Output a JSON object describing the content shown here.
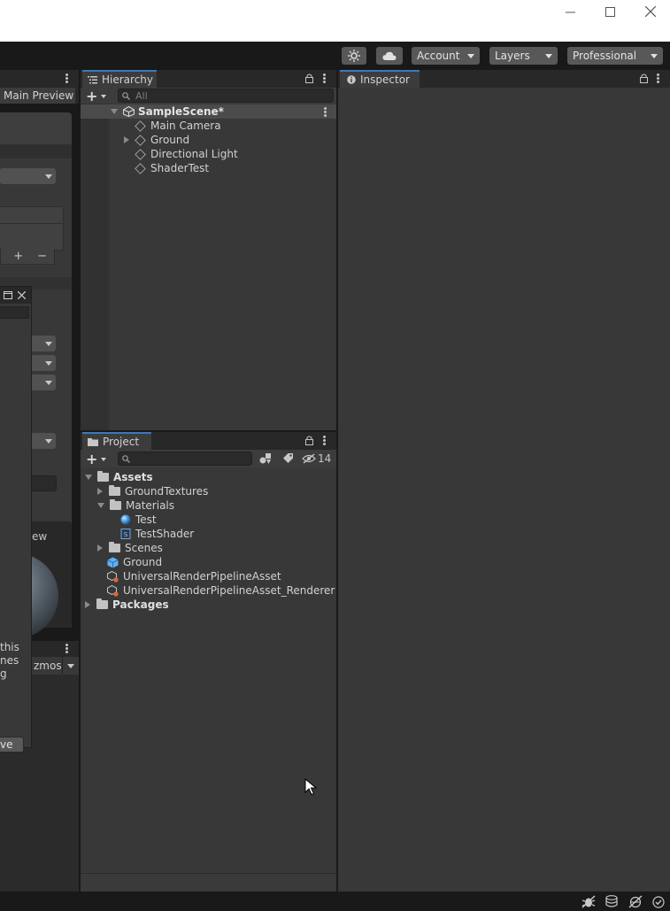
{
  "window": {
    "controls": [
      "minimize-icon",
      "maximize-icon",
      "close-icon"
    ]
  },
  "toolbar": {
    "account_label": "Account",
    "layers_label": "Layers",
    "layout_label": "Professional"
  },
  "left_panel": {
    "main_preview_tab": "Main Preview",
    "preview_fragment": "ew",
    "gizmos_fragment": "zmos",
    "dialog_button_fragment": "ve",
    "text_fragments": [
      "this",
      "nes",
      "g"
    ]
  },
  "hierarchy": {
    "tab_label": "Hierarchy",
    "search_placeholder": "All",
    "scene_name": "SampleScene*",
    "items": [
      {
        "label": "Main Camera",
        "expandable": false
      },
      {
        "label": "Ground",
        "expandable": true
      },
      {
        "label": "Directional Light",
        "expandable": false
      },
      {
        "label": "ShaderTest",
        "expandable": false
      }
    ]
  },
  "inspector": {
    "tab_label": "Inspector"
  },
  "project": {
    "tab_label": "Project",
    "hidden_count": "14",
    "tree": {
      "assets_label": "Assets",
      "packages_label": "Packages",
      "folders": [
        {
          "label": "GroundTextures",
          "expanded": false
        },
        {
          "label": "Materials",
          "expanded": true
        },
        {
          "label": "Scenes",
          "expanded": false
        }
      ],
      "materials_children": [
        {
          "label": "Test",
          "icon": "material-sphere-icon"
        },
        {
          "label": "TestShader",
          "icon": "shader-icon"
        }
      ],
      "assets": [
        {
          "label": "Ground",
          "icon": "prefab-cube-icon"
        },
        {
          "label": "UniversalRenderPipelineAsset",
          "icon": "pipeline-asset-icon"
        },
        {
          "label": "UniversalRenderPipelineAsset_Renderer",
          "icon": "pipeline-asset-icon"
        }
      ]
    }
  },
  "colors": {
    "accent": "#3a79bb",
    "panel_bg": "#383838",
    "toolbar_bg": "#191919",
    "prefab_blue": "#5fb2f5"
  }
}
